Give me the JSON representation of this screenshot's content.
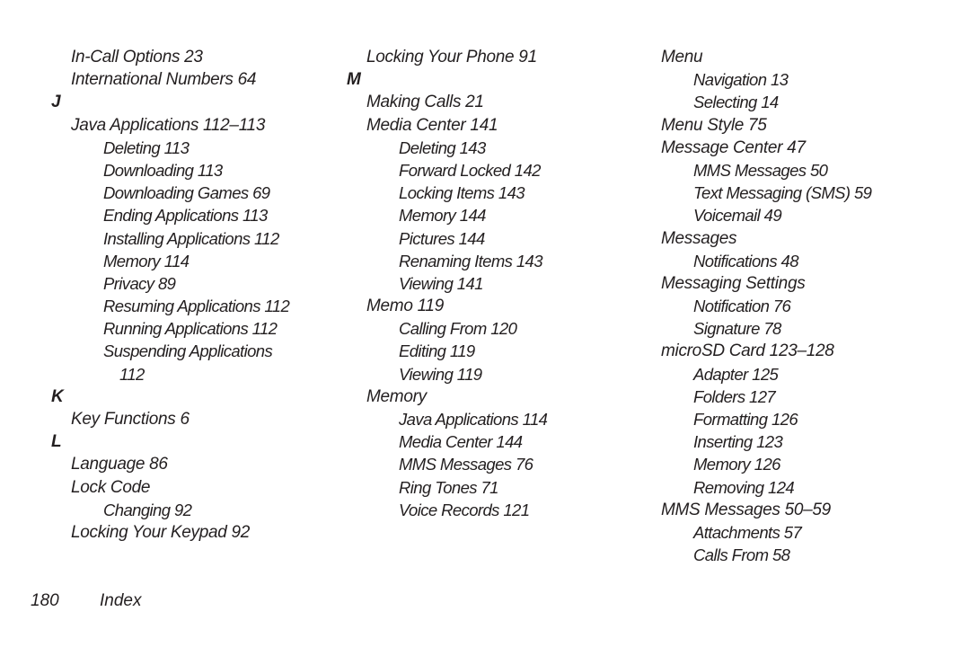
{
  "columns": [
    {
      "entries": [
        {
          "level": 1,
          "text": "In-Call Options 23"
        },
        {
          "level": 1,
          "text": "International Numbers 64"
        },
        {
          "level": 0,
          "text": "J"
        },
        {
          "level": 1,
          "text": "Java Applications 112–113"
        },
        {
          "level": 2,
          "text": "Deleting 113"
        },
        {
          "level": 2,
          "text": "Downloading 113"
        },
        {
          "level": 2,
          "text": "Downloading Games 69"
        },
        {
          "level": 2,
          "text": "Ending Applications 113"
        },
        {
          "level": 2,
          "text": "Installing Applications 112"
        },
        {
          "level": 2,
          "text": "Memory 114"
        },
        {
          "level": 2,
          "text": "Privacy 89"
        },
        {
          "level": 2,
          "text": "Resuming Applications 112"
        },
        {
          "level": 2,
          "text": "Running Applications 112"
        },
        {
          "level": 2,
          "text": "Suspending Applications"
        },
        {
          "level": 3,
          "text": "112"
        },
        {
          "level": 0,
          "text": "K"
        },
        {
          "level": 1,
          "text": "Key Functions 6"
        },
        {
          "level": 0,
          "text": "L"
        },
        {
          "level": 1,
          "text": "Language 86"
        },
        {
          "level": 1,
          "text": "Lock Code"
        },
        {
          "level": 2,
          "text": "Changing 92"
        },
        {
          "level": 1,
          "text": "Locking Your Keypad 92"
        }
      ]
    },
    {
      "entries": [
        {
          "level": 1,
          "text": "Locking Your Phone 91"
        },
        {
          "level": 0,
          "text": "M"
        },
        {
          "level": 1,
          "text": "Making Calls 21"
        },
        {
          "level": 1,
          "text": "Media Center 141"
        },
        {
          "level": 2,
          "text": "Deleting 143"
        },
        {
          "level": 2,
          "text": "Forward Locked 142"
        },
        {
          "level": 2,
          "text": "Locking Items 143"
        },
        {
          "level": 2,
          "text": "Memory 144"
        },
        {
          "level": 2,
          "text": "Pictures 144"
        },
        {
          "level": 2,
          "text": "Renaming Items 143"
        },
        {
          "level": 2,
          "text": "Viewing 141"
        },
        {
          "level": 1,
          "text": "Memo 119"
        },
        {
          "level": 2,
          "text": "Calling From 120"
        },
        {
          "level": 2,
          "text": "Editing 119"
        },
        {
          "level": 2,
          "text": "Viewing 119"
        },
        {
          "level": 1,
          "text": "Memory"
        },
        {
          "level": 2,
          "text": "Java Applications 114"
        },
        {
          "level": 2,
          "text": "Media Center 144"
        },
        {
          "level": 2,
          "text": "MMS Messages 76"
        },
        {
          "level": 2,
          "text": "Ring Tones 71"
        },
        {
          "level": 2,
          "text": "Voice Records 121"
        }
      ]
    },
    {
      "entries": [
        {
          "level": 1,
          "text": "Menu"
        },
        {
          "level": 2,
          "text": "Navigation 13"
        },
        {
          "level": 2,
          "text": "Selecting 14"
        },
        {
          "level": 1,
          "text": "Menu Style 75"
        },
        {
          "level": 1,
          "text": "Message Center 47"
        },
        {
          "level": 2,
          "text": "MMS Messages 50"
        },
        {
          "level": 2,
          "text": "Text Messaging (SMS) 59"
        },
        {
          "level": 2,
          "text": "Voicemail 49"
        },
        {
          "level": 1,
          "text": "Messages"
        },
        {
          "level": 2,
          "text": "Notifications 48"
        },
        {
          "level": 1,
          "text": "Messaging Settings"
        },
        {
          "level": 2,
          "text": "Notification 76"
        },
        {
          "level": 2,
          "text": "Signature 78"
        },
        {
          "level": 1,
          "text": "microSD Card 123–128"
        },
        {
          "level": 2,
          "text": "Adapter 125"
        },
        {
          "level": 2,
          "text": "Folders 127"
        },
        {
          "level": 2,
          "text": "Formatting 126"
        },
        {
          "level": 2,
          "text": "Inserting 123"
        },
        {
          "level": 2,
          "text": "Memory 126"
        },
        {
          "level": 2,
          "text": "Removing 124"
        },
        {
          "level": 1,
          "text": "MMS Messages 50–59"
        },
        {
          "level": 2,
          "text": "Attachments 57"
        },
        {
          "level": 2,
          "text": "Calls From 58"
        }
      ]
    }
  ],
  "footer": {
    "page_number": "180",
    "section": "Index"
  }
}
